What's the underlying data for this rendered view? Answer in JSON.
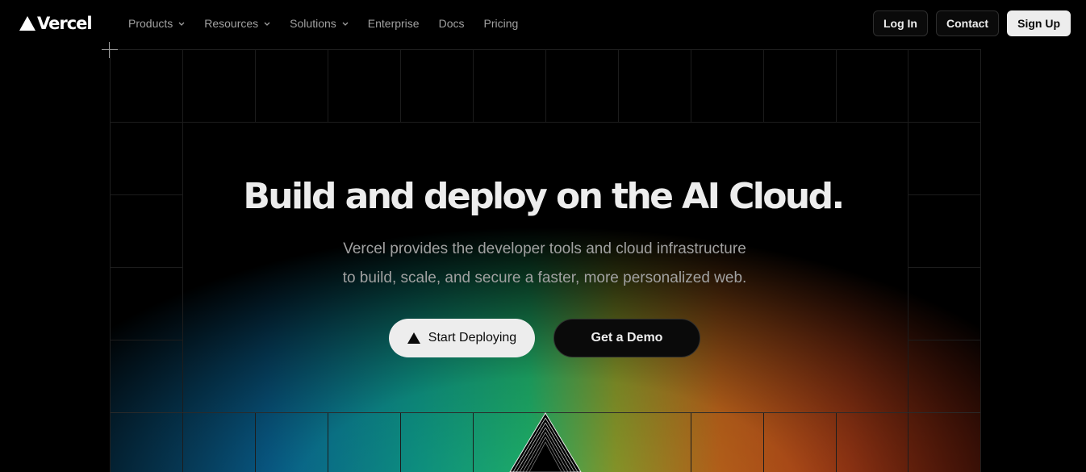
{
  "brand": {
    "name": "Vercel",
    "logo_icon": "vercel-triangle-icon"
  },
  "nav": {
    "items": [
      {
        "label": "Products",
        "has_dropdown": true
      },
      {
        "label": "Resources",
        "has_dropdown": true
      },
      {
        "label": "Solutions",
        "has_dropdown": true
      },
      {
        "label": "Enterprise",
        "has_dropdown": false
      },
      {
        "label": "Docs",
        "has_dropdown": false
      },
      {
        "label": "Pricing",
        "has_dropdown": false
      }
    ],
    "login_label": "Log In",
    "contact_label": "Contact",
    "signup_label": "Sign Up"
  },
  "hero": {
    "title": "Build and deploy on the AI Cloud.",
    "subtitle_line1": "Vercel provides the developer tools and cloud infrastructure",
    "subtitle_line2": "to build, scale, and secure a faster, more personalized web.",
    "primary_cta": "Start Deploying",
    "secondary_cta": "Get a Demo"
  },
  "colors": {
    "background": "#000000",
    "text": "#ededed",
    "muted": "#a1a1a1",
    "gradient": [
      "#0a6fa5",
      "#1eb06a",
      "#c6681c",
      "#9e2a10"
    ]
  }
}
